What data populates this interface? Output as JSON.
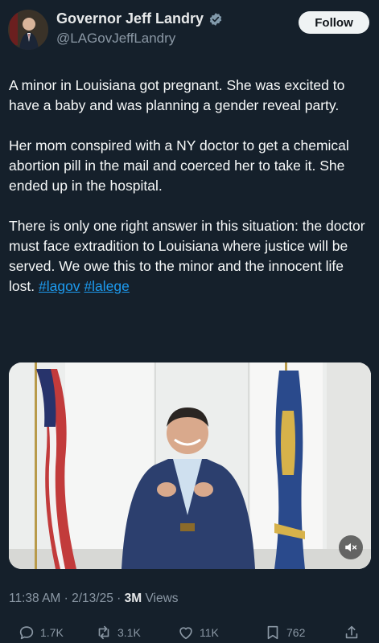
{
  "author": {
    "display_name": "Governor Jeff Landry",
    "handle": "@LAGovJeffLandry",
    "verified_icon": "verified-badge-icon"
  },
  "follow_label": "Follow",
  "tweet": {
    "paragraph1": "A minor in Louisiana got pregnant. She was excited to have a baby and was planning a gender reveal party.",
    "paragraph2": "Her mom conspired with a NY doctor to get a chemical abortion pill in the mail and coerced her to take it. She ended up in the hospital.",
    "paragraph3": "There is only one right answer in this situation: the doctor must face extradition to Louisiana where justice will be served. We owe this to the minor and the innocent life lost.",
    "hashtags": [
      "#lagov",
      "#lalege"
    ]
  },
  "meta": {
    "time": "11:38 AM",
    "date": "2/13/25",
    "views_count": "3M",
    "views_label": "Views"
  },
  "actions": {
    "replies": "1.7K",
    "reposts": "3.1K",
    "likes": "11K",
    "bookmarks": "762"
  },
  "colors": {
    "background": "#15202b",
    "link": "#1d9bf0",
    "muted": "#8b98a5"
  }
}
